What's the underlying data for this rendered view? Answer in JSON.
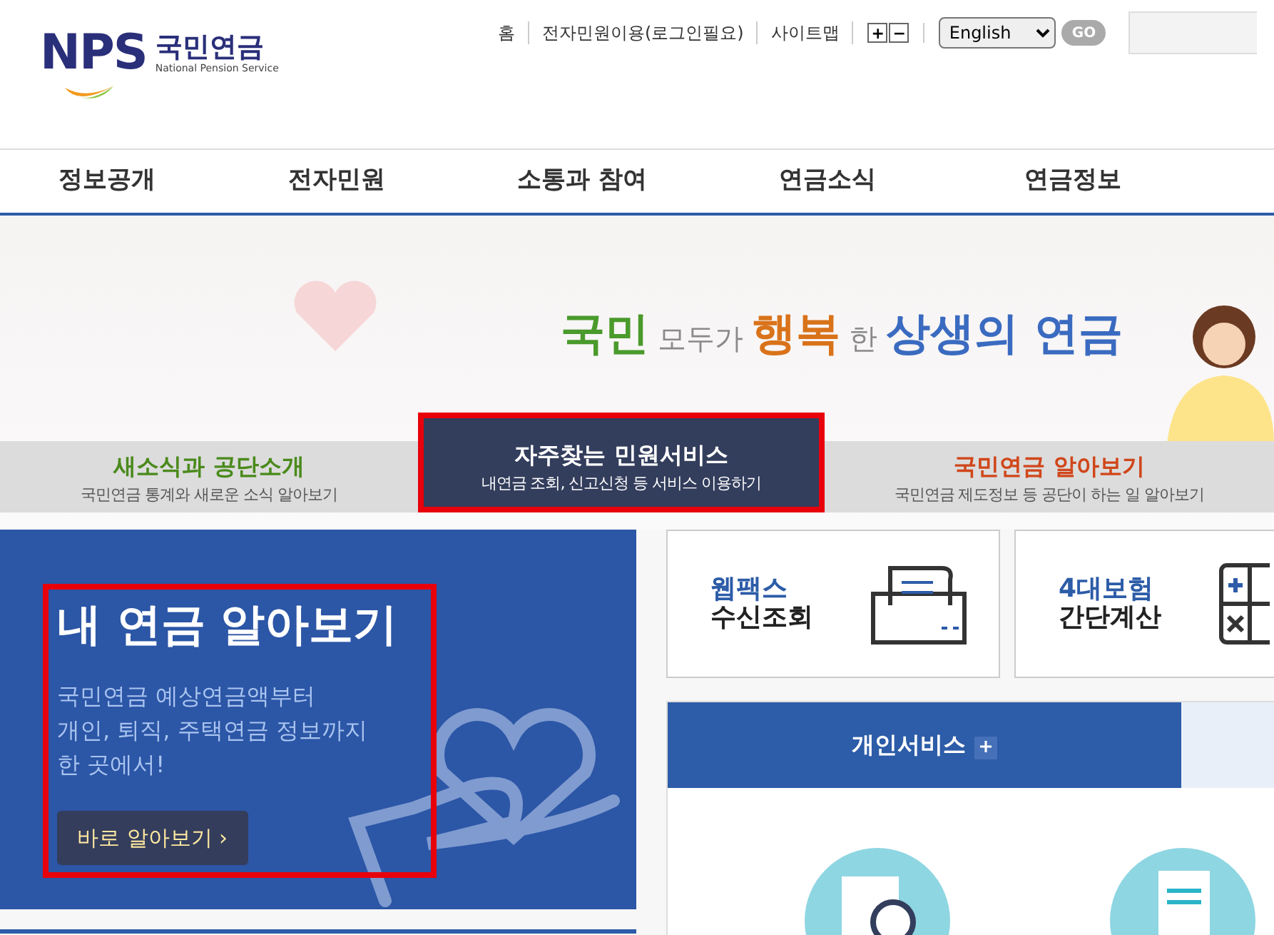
{
  "header": {
    "logo": {
      "mark": "NPS",
      "name": "국민연금",
      "subtitle": "National Pension Service"
    },
    "util_links": [
      "홈",
      "전자민원이용(로그인필요)",
      "사이트맵"
    ],
    "font_size": {
      "increase": "+",
      "decrease": "−"
    },
    "language": {
      "value": "English",
      "button": "GO"
    }
  },
  "nav": [
    "정보공개",
    "전자민원",
    "소통과 참여",
    "연금소식",
    "연금정보"
  ],
  "banner": {
    "slogan": [
      {
        "text": "국민",
        "color": "#4a9a2c",
        "big": true
      },
      {
        "text": "모두가",
        "color": "#8a8a8a",
        "big": false
      },
      {
        "text": "행복",
        "color": "#d9731a",
        "big": true
      },
      {
        "text": "한",
        "color": "#8a8a8a",
        "big": false
      },
      {
        "text": "상생의 연금",
        "color": "#3a6bc0",
        "big": true
      }
    ]
  },
  "quick_tabs": [
    {
      "title": "새소식과 공단소개",
      "desc": "국민연금 통계와 새로운 소식 알아보기",
      "color": "#4a8a1c",
      "selected": false,
      "highlighted": false
    },
    {
      "title": "자주찾는 민원서비스",
      "desc": "내연금 조회, 신고신청 등 서비스 이용하기",
      "color": "#ffffff",
      "selected": true,
      "highlighted": true
    },
    {
      "title": "국민연금 알아보기",
      "desc": "국민연금 제도정보 등 공단이 하는 일 알아보기",
      "color": "#d0461a",
      "selected": false,
      "highlighted": false
    }
  ],
  "hero": {
    "title": "내 연금 알아보기",
    "lines": [
      "국민연금 예상연금액부터",
      "개인, 퇴직, 주택연금 정보까지",
      "한 곳에서!"
    ],
    "button": "바로 알아보기 ›",
    "highlighted": true
  },
  "service_cards": [
    {
      "title": "웹팩스",
      "subtitle": "수신조회",
      "kind": "fax"
    },
    {
      "title": "4대보험",
      "subtitle": "간단계산",
      "kind": "calculator"
    }
  ],
  "service_tabs": [
    {
      "label": "개인서비스",
      "selected": true
    }
  ]
}
